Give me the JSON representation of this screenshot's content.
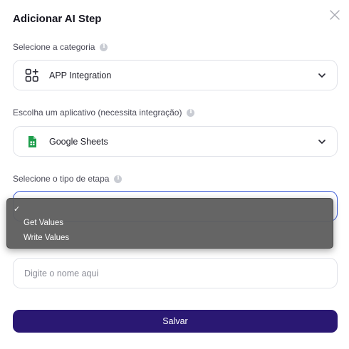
{
  "modal": {
    "title": "Adicionar AI Step",
    "close_icon": "close-icon"
  },
  "category": {
    "label": "Selecione a categoria",
    "value": "APP Integration",
    "icon": "app-grid-plus-icon"
  },
  "app": {
    "label": "Escolha um aplicativo (necessita integração)",
    "value": "Google Sheets",
    "icon": "google-sheets-icon"
  },
  "step_type": {
    "label": "Selecione o tipo de etapa",
    "value": "",
    "dropdown": {
      "selected_mark": "✓",
      "options": [
        "Get Values",
        "Write Values"
      ]
    }
  },
  "name": {
    "placeholder": "Digite o nome aqui"
  },
  "save_label": "Salvar",
  "colors": {
    "accent": "#2a1873",
    "focus_border": "#3b5bd6",
    "sheets_green": "#1e9e4c",
    "dropdown_bg": "#5f5f5f"
  }
}
